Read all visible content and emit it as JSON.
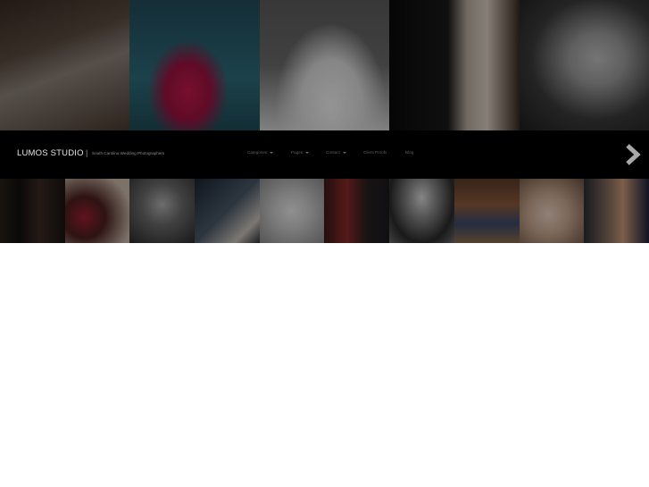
{
  "brand": {
    "name": "LUMOS STUDIO",
    "separator": "|",
    "tagline": "South Carolina Wedding Photographers"
  },
  "nav": [
    {
      "label": "Categories",
      "has_dropdown": true
    },
    {
      "label": "Pages",
      "has_dropdown": true
    },
    {
      "label": "Contact",
      "has_dropdown": true
    },
    {
      "label": "Client Proofs",
      "has_dropdown": false
    },
    {
      "label": "Blog",
      "has_dropdown": false
    }
  ],
  "gallery_top": [
    {
      "icon": "photo-bride-seated"
    },
    {
      "icon": "photo-bride-floating-red-dress"
    },
    {
      "icon": "photo-bride-reclining-white"
    },
    {
      "icon": "photo-couple-holding-hands"
    },
    {
      "icon": "photo-baby-portrait"
    }
  ],
  "gallery_bottom": [
    {
      "icon": "thumb-groomsmen"
    },
    {
      "icon": "thumb-bouquet"
    },
    {
      "icon": "thumb-child"
    },
    {
      "icon": "thumb-couple-sign"
    },
    {
      "icon": "thumb-bride-bouquet"
    },
    {
      "icon": "thumb-couple-kiss"
    },
    {
      "icon": "thumb-outdoor-couple"
    },
    {
      "icon": "thumb-family"
    },
    {
      "icon": "thumb-baby"
    },
    {
      "icon": "thumb-bride-portrait"
    }
  ],
  "colors": {
    "navbar_bg": "#000000",
    "logo_text": "#e6e6e6",
    "nav_text": "#5e5e5e",
    "page_bg": "#ffffff"
  }
}
